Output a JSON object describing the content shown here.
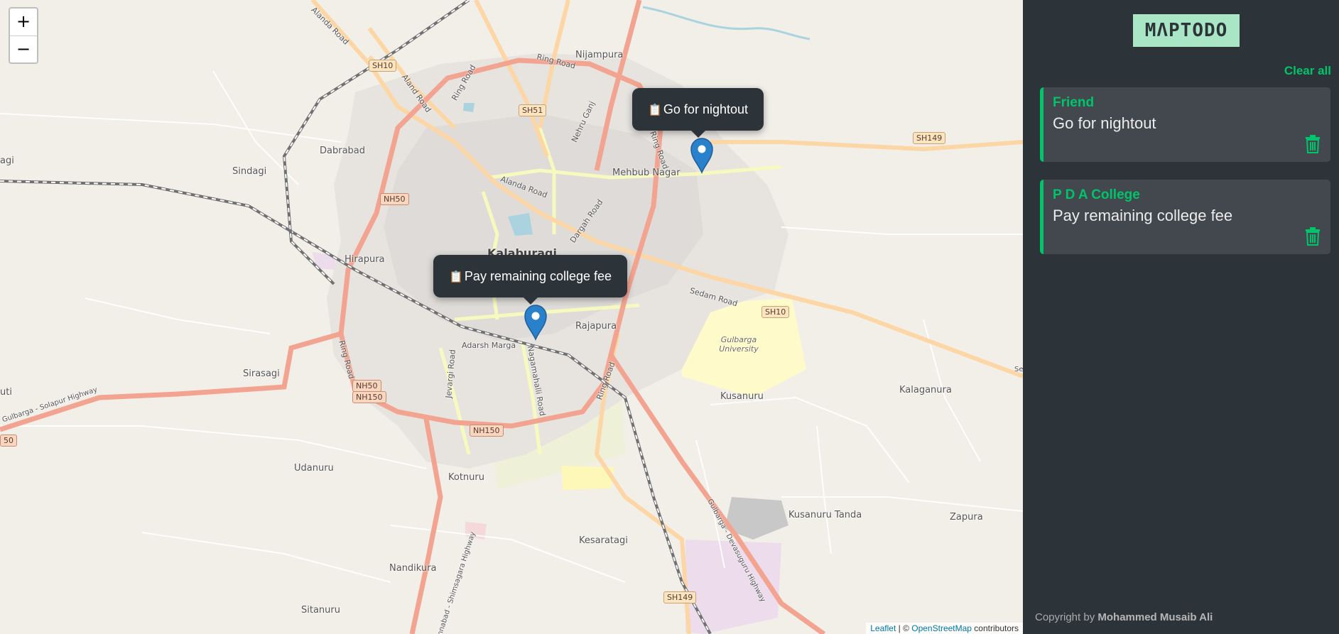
{
  "map": {
    "zoom_in": "+",
    "zoom_out": "−",
    "places": [
      {
        "id": "nijampura",
        "label": "Nijampura"
      },
      {
        "id": "dabrabad",
        "label": "Dabrabad"
      },
      {
        "id": "sindagi",
        "label": "Sindagi"
      },
      {
        "id": "mehbub",
        "label": "Mehbub Nagar"
      },
      {
        "id": "kalaburagi",
        "label": "Kalaburagi"
      },
      {
        "id": "hirapura",
        "label": "Hirapura"
      },
      {
        "id": "rajapura",
        "label": "Rajapura"
      },
      {
        "id": "sirasagi",
        "label": "Sirasagi"
      },
      {
        "id": "kusanuru",
        "label": "Kusanuru"
      },
      {
        "id": "kalaganura",
        "label": "Kalaganura"
      },
      {
        "id": "udanuru",
        "label": "Udanuru"
      },
      {
        "id": "kotnuru",
        "label": "Kotnuru"
      },
      {
        "id": "kusanuru_tanda",
        "label": "Kusanuru Tanda"
      },
      {
        "id": "zapura",
        "label": "Zapura"
      },
      {
        "id": "kesaratagi",
        "label": "Kesaratagi"
      },
      {
        "id": "nandikura",
        "label": "Nandikura"
      },
      {
        "id": "sitanuru",
        "label": "Sitanuru"
      },
      {
        "id": "uti",
        "label": "uti"
      },
      {
        "id": "agi",
        "label": "agi"
      },
      {
        "id": "gulbarga_university",
        "label": "Gulbarga University"
      }
    ],
    "shields": [
      "SH10",
      "SH51",
      "NH50",
      "SH149",
      "SH10",
      "NH50",
      "NH150",
      "NH150",
      "SH149",
      "50"
    ],
    "road_labels": [
      "Ring Road",
      "Alanda Road",
      "Aland Road",
      "Ring Road",
      "Nehru Ganj",
      "Ring Road",
      "Dargah Road",
      "Sedam Road",
      "Alanda Road",
      "Adarsh Marga",
      "Jevargi Road",
      "Nagamahalli Road",
      "Ring Road",
      "Ring Road",
      "Gulbarga - Solapur Highway",
      "Gulbarga - Devasuguru Highway",
      "Humnabad - Shimsagara Highway",
      "Se"
    ],
    "popups": [
      {
        "icon": "📋",
        "text": "Go for nightout"
      },
      {
        "icon": "📋",
        "text": "Pay remaining college fee"
      }
    ],
    "marker_color": "#2a81cb",
    "attribution": {
      "leaflet": "Leaflet",
      "sep": " | © ",
      "osm": "OpenStreetMap",
      "suffix": " contributors"
    }
  },
  "sidebar": {
    "logo": "MΛPTODO",
    "clear_all": "Clear all",
    "todos": [
      {
        "title": "Friend",
        "description": "Go for nightout"
      },
      {
        "title": "P D A College",
        "description": "Pay remaining college fee"
      }
    ],
    "copyright_prefix": "Copyright by ",
    "copyright_name": "Mohammed Musaib Ali",
    "accent_color": "#00c46a",
    "bg_color": "#2d3439"
  }
}
